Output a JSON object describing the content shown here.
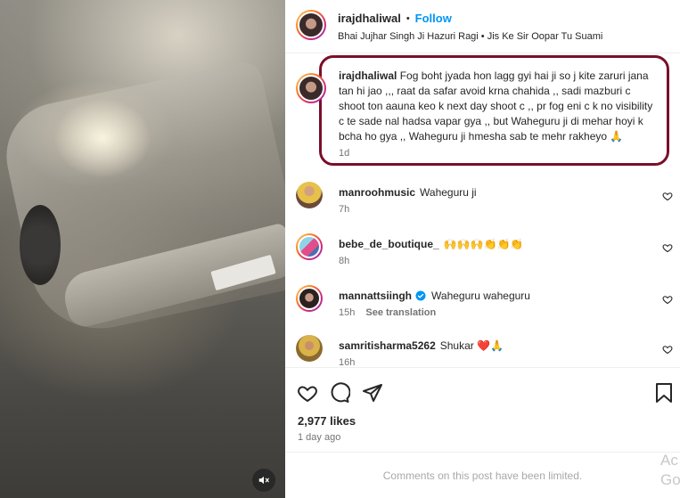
{
  "post": {
    "username": "irajdhaliwal",
    "separator": "•",
    "follow_label": "Follow",
    "audio": "Bhai Jujhar Singh Ji Hazuri Ragi • Jis Ke Sir Oopar Tu Suami"
  },
  "caption": {
    "username": "irajdhaliwal",
    "text": "Fog boht jyada hon lagg gyi hai ji so j kite zaruri jana tan hi jao ,,, raat da safar avoid krna chahida ,, sadi mazburi c shoot ton aauna keo k next day shoot c ,, pr fog eni c k no visibility c te sade nal hadsa vapar gya ,, but Waheguru ji di mehar hoyi k bcha ho gya ,, Waheguru ji hmesha sab te mehr rakheyo 🙏",
    "time": "1d"
  },
  "comments": [
    {
      "username": "manroohmusic",
      "text": "Waheguru ji",
      "time": "7h",
      "verified": false,
      "translate": ""
    },
    {
      "username": "bebe_de_boutique_",
      "text": "🙌🙌🙌👏👏👏",
      "time": "8h",
      "verified": false,
      "translate": ""
    },
    {
      "username": "mannattsiingh",
      "text": "Waheguru waheguru",
      "time": "15h",
      "verified": true,
      "translate": "See translation"
    },
    {
      "username": "samritisharma5262",
      "text": "Shukar ❤️🙏",
      "time": "16h",
      "verified": false,
      "translate": ""
    }
  ],
  "stats": {
    "likes": "2,977 likes",
    "date": "1 day ago"
  },
  "footer": {
    "limited": "Comments on this post have been limited.",
    "watermark": "Ac Go"
  },
  "colors": {
    "follow": "#0095f6",
    "highlight_border": "#7a0f2a",
    "verified": "#0095f6",
    "muted": "#737373"
  },
  "icons": [
    "mute-icon",
    "heart-icon",
    "comment-icon",
    "share-icon",
    "bookmark-icon",
    "verified-icon"
  ]
}
